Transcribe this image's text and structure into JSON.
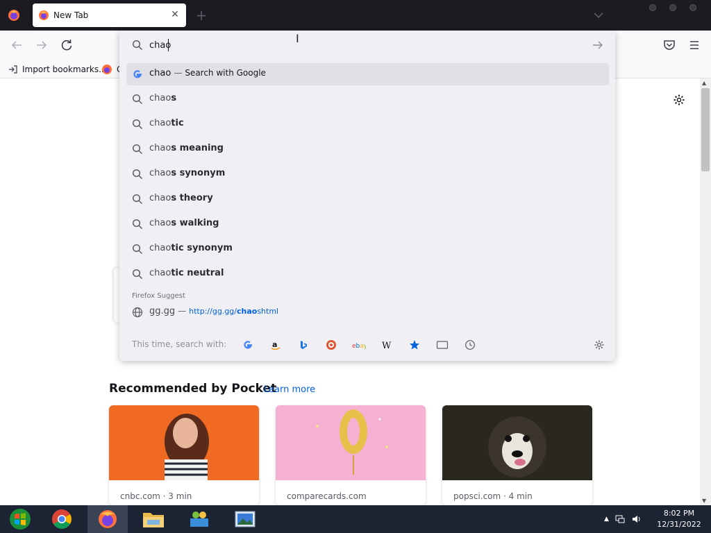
{
  "browser": {
    "tab_title": "New Tab"
  },
  "bookmarks": {
    "import_label": "Import bookmarks...",
    "getting_started_label": "Ge"
  },
  "urlbar": {
    "value": "chao",
    "rows": [
      {
        "typed": "chao",
        "rest": "",
        "action": "Search with Google",
        "kind": "engine"
      },
      {
        "typed": "chao",
        "rest": "s",
        "kind": "suggestion"
      },
      {
        "typed": "chao",
        "rest": "tic",
        "kind": "suggestion"
      },
      {
        "typed": "chao",
        "rest": "s meaning",
        "kind": "suggestion"
      },
      {
        "typed": "chao",
        "rest": "s synonym",
        "kind": "suggestion"
      },
      {
        "typed": "chao",
        "rest": "s theory",
        "kind": "suggestion"
      },
      {
        "typed": "chao",
        "rest": "s walking",
        "kind": "suggestion"
      },
      {
        "typed": "chao",
        "rest": "tic synonym",
        "kind": "suggestion"
      },
      {
        "typed": "chao",
        "rest": "tic neutral",
        "kind": "suggestion"
      }
    ],
    "suggest_group_label": "Firefox Suggest",
    "suggest_row": {
      "title": "gg.gg",
      "url_prefix": "http://gg.gg/",
      "url_match": "chao",
      "url_rest": "shtml"
    },
    "oneoff_label": "This time, search with:",
    "engines": [
      "google-icon",
      "amazon-icon",
      "bing-icon",
      "duckduckgo-icon",
      "ebay-icon",
      "wikipedia-icon",
      "bookmarks-star-icon",
      "tabs-icon",
      "history-icon"
    ]
  },
  "pocket": {
    "heading": "Recommended by Pocket",
    "learn_more": "Learn more",
    "cards": [
      {
        "source": "cnbc.com · 3 min"
      },
      {
        "source": "comparecards.com"
      },
      {
        "source": "popsci.com · 4 min"
      }
    ]
  },
  "taskbar": {
    "time": "8:02 PM",
    "date": "12/31/2022"
  },
  "colors": {
    "accent": "#0060df",
    "tabstrip": "#1c1b22",
    "dropdown": "#f0f0f4",
    "taskbar": "#1c2333"
  }
}
